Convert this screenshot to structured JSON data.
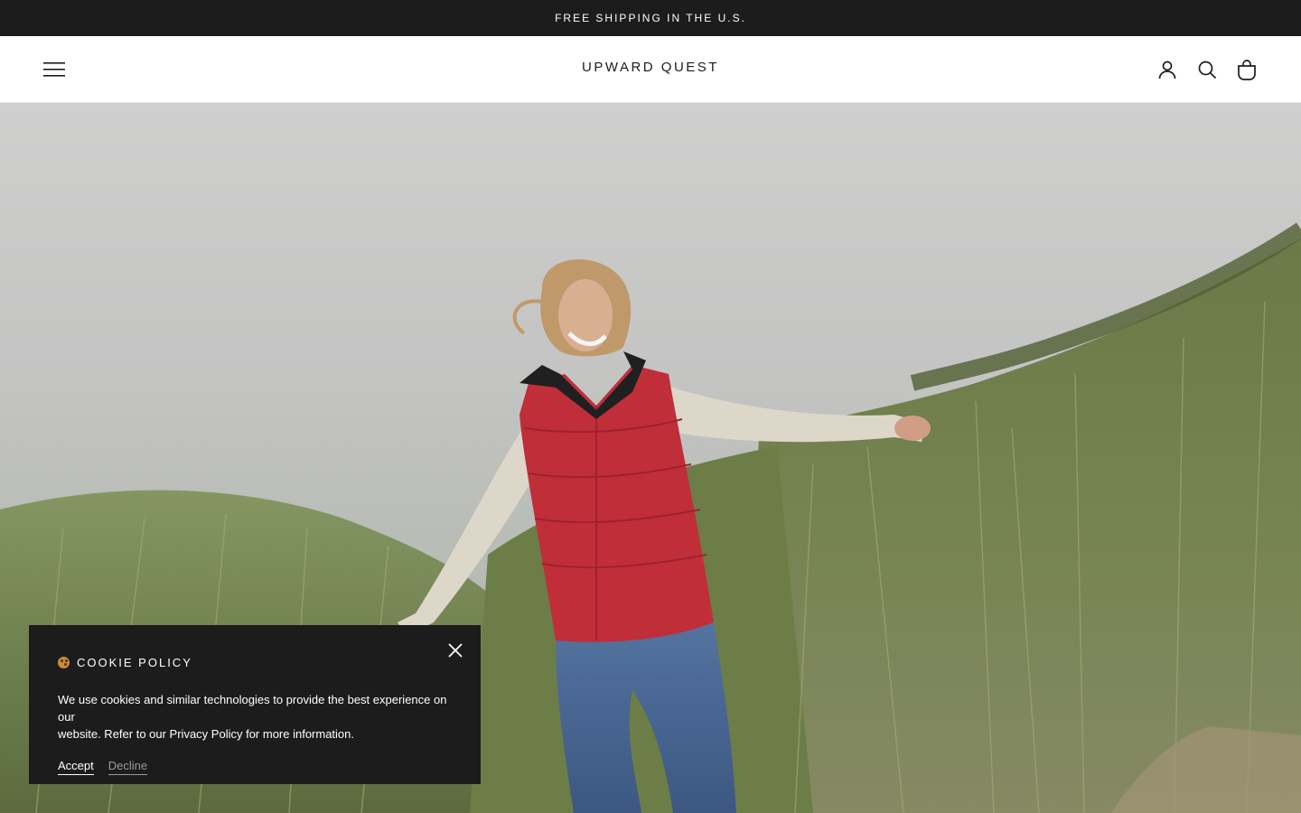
{
  "announcement": {
    "text": "FREE SHIPPING IN THE U.S."
  },
  "header": {
    "logo": "UPWARD QUEST",
    "menu_icon": "hamburger-menu-icon",
    "icons": [
      "account-icon",
      "search-icon",
      "cart-icon"
    ]
  },
  "hero": {
    "image": "woman-in-red-vest-running-through-dune-grass"
  },
  "cookie": {
    "title": "COOKIE POLICY",
    "emoji": "cookie-icon",
    "text_line1": "We use cookies and similar technologies to provide the best experience on our",
    "text_line2": "website. Refer to our Privacy Policy for more information.",
    "accept_label": "Accept",
    "decline_label": "Decline",
    "close_icon": "close-icon"
  },
  "colors": {
    "dark": "#1c1c1c",
    "white": "#ffffff",
    "muted": "#9a9a9a"
  }
}
